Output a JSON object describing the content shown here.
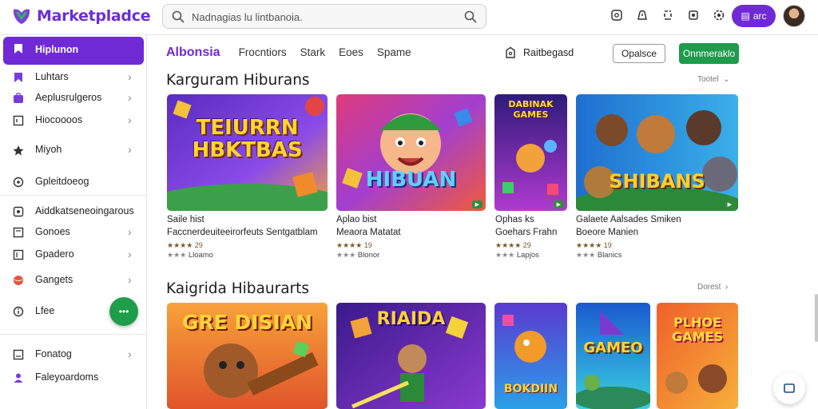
{
  "app": {
    "logo_text": "Marketpladce"
  },
  "search": {
    "value": "Nadnagias lu lintbanoia."
  },
  "header": {
    "pill_label": "arc"
  },
  "sidebar": {
    "items": [
      {
        "label": "Hiplunon",
        "icon": "bookmark-icon",
        "active": true
      },
      {
        "label": "Luhtars",
        "icon": "bookmark-icon"
      },
      {
        "label": "Aeplusrulgeros",
        "icon": "briefcase-icon"
      },
      {
        "label": "Hiocoooos",
        "icon": "box-icon"
      },
      {
        "label": "Miyoh",
        "icon": "star-icon"
      },
      {
        "label": "Gpleitdoeog",
        "icon": "circle-icon"
      },
      {
        "label": "Aiddkatseneoingarous",
        "icon": "box-icon"
      },
      {
        "label": "Gonoes",
        "icon": "box-icon"
      },
      {
        "label": "Gpadero",
        "icon": "box-icon"
      },
      {
        "label": "Gangets",
        "icon": "ball-icon"
      },
      {
        "label": "Lfee",
        "icon": "info-icon"
      },
      {
        "label": "Fonatog",
        "icon": "box-icon"
      },
      {
        "label": "Faleyoardoms",
        "icon": "user-icon"
      }
    ],
    "fab_label": "•••"
  },
  "tabs": [
    "Albonsia",
    "Frocntiors",
    "Stark",
    "Eoes",
    "Spame"
  ],
  "toolbar": {
    "bag_label": "Raitbegasd",
    "outline_button": "Opalsce",
    "green_button": "Onnmeraklo"
  },
  "sections": [
    {
      "title": "Karguram Hiburans",
      "see_more": "Tootel",
      "cards": [
        {
          "art_title": "TEIURRN HBKTBAS",
          "line1": "Saile hist",
          "line2": "Faccnerdeuiteeirorfeuts Sentgatblam",
          "rating": "★★★★ 29",
          "sub": "Lloamo"
        },
        {
          "art_title": "HIBUAN",
          "line1": "Aplao bist",
          "line2": "Meaora Matatat",
          "rating": "★★★★ 19",
          "sub": "Blonor"
        },
        {
          "art_title": "DABINAK GAMES",
          "line1": "Ophas ks",
          "line2": "Goehars Frahn",
          "rating": "★★★★ 29",
          "sub": "Lapjos"
        },
        {
          "art_title": "SHIBANS",
          "line1": "Galaete Aalsades Smiken",
          "line2": "Boeore Manien",
          "rating": "★★★★ 19",
          "sub": "Blanics"
        }
      ]
    },
    {
      "title": "Kaigrida Hibaurarts",
      "see_more": "Dorest",
      "cards": [
        {
          "art_title": "GRE DISIAN"
        },
        {
          "art_title": "RIAIDA"
        },
        {
          "art_title": "BOKDIIN"
        },
        {
          "art_title": "GAMEO"
        },
        {
          "art_title": "PLHOE GAMES"
        }
      ]
    }
  ]
}
